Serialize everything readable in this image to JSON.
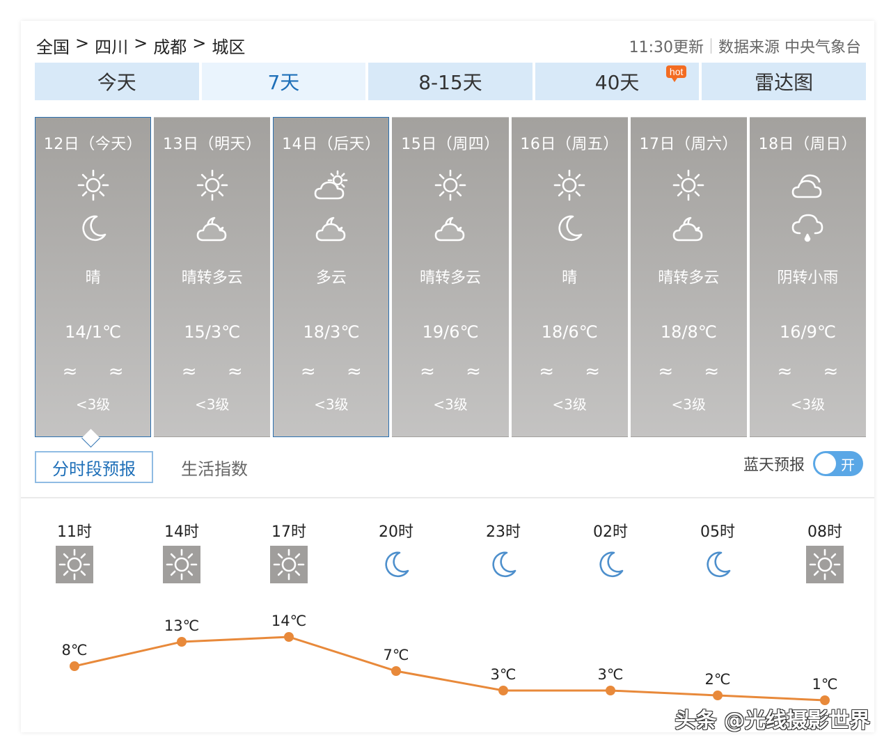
{
  "breadcrumb": [
    "全国",
    "四川",
    "成都",
    "城区"
  ],
  "breadcrumb_sep": ">",
  "update_time": "11:30更新",
  "data_source": "数据来源 中央气象台",
  "tabs": [
    {
      "label": "今天",
      "active": false
    },
    {
      "label": "7天",
      "active": true
    },
    {
      "label": "8-15天",
      "active": false
    },
    {
      "label": "40天",
      "active": false,
      "badge": "hot"
    },
    {
      "label": "雷达图",
      "active": false
    }
  ],
  "days": [
    {
      "date": "12日（今天）",
      "day_icon": "sun-icon",
      "night_icon": "moon-icon",
      "condition": "晴",
      "temp": "14/1℃",
      "wind": "≈ ≈",
      "level": "<3级"
    },
    {
      "date": "13日（明天）",
      "day_icon": "sun-icon",
      "night_icon": "moon-cloud-icon",
      "condition": "晴转多云",
      "temp": "15/3℃",
      "wind": "≈ ≈",
      "level": "<3级"
    },
    {
      "date": "14日（后天）",
      "day_icon": "sun-cloud-icon",
      "night_icon": "moon-cloud-icon",
      "condition": "多云",
      "temp": "18/3℃",
      "wind": "≈ ≈",
      "level": "<3级"
    },
    {
      "date": "15日（周四）",
      "day_icon": "sun-icon",
      "night_icon": "moon-cloud-icon",
      "condition": "晴转多云",
      "temp": "19/6℃",
      "wind": "≈ ≈",
      "level": "<3级"
    },
    {
      "date": "16日（周五）",
      "day_icon": "sun-icon",
      "night_icon": "moon-icon",
      "condition": "晴",
      "temp": "18/6℃",
      "wind": "≈ ≈",
      "level": "<3级"
    },
    {
      "date": "17日（周六）",
      "day_icon": "sun-icon",
      "night_icon": "moon-cloud-icon",
      "condition": "晴转多云",
      "temp": "18/8℃",
      "wind": "≈ ≈",
      "level": "<3级"
    },
    {
      "date": "18日（周日）",
      "day_icon": "cloud-icon",
      "night_icon": "rain-cloud-icon",
      "condition": "阴转小雨",
      "temp": "16/9℃",
      "wind": "≈ ≈",
      "level": "<3级"
    }
  ],
  "subtabs": {
    "active": "分时段预报",
    "other": "生活指数"
  },
  "blue_sky": {
    "label": "蓝天预报",
    "toggle_text": "开",
    "on": true
  },
  "hourly": [
    {
      "hour": "11时",
      "icon": "sun-icon"
    },
    {
      "hour": "14时",
      "icon": "sun-icon"
    },
    {
      "hour": "17时",
      "icon": "sun-icon"
    },
    {
      "hour": "20时",
      "icon": "moon-icon"
    },
    {
      "hour": "23时",
      "icon": "moon-icon"
    },
    {
      "hour": "02时",
      "icon": "moon-icon"
    },
    {
      "hour": "05时",
      "icon": "moon-icon"
    },
    {
      "hour": "08时",
      "icon": "sun-icon"
    }
  ],
  "chart_data": {
    "type": "line",
    "x": [
      "11时",
      "14时",
      "17时",
      "20时",
      "23时",
      "02时",
      "05时",
      "08时"
    ],
    "series": [
      {
        "values": [
          8,
          13,
          14,
          7,
          3,
          3,
          2,
          1
        ]
      }
    ],
    "value_labels": [
      "8℃",
      "13℃",
      "14℃",
      "7℃",
      "3℃",
      "3℃",
      "2℃",
      "1℃"
    ],
    "color": "#e8893a"
  },
  "watermark": "头条 @光线摄影世界",
  "colors": {
    "accent": "#1e6fb8",
    "tab_bg": "#d8e9f8",
    "day_card": "#a3a19e",
    "line": "#e8893a"
  }
}
